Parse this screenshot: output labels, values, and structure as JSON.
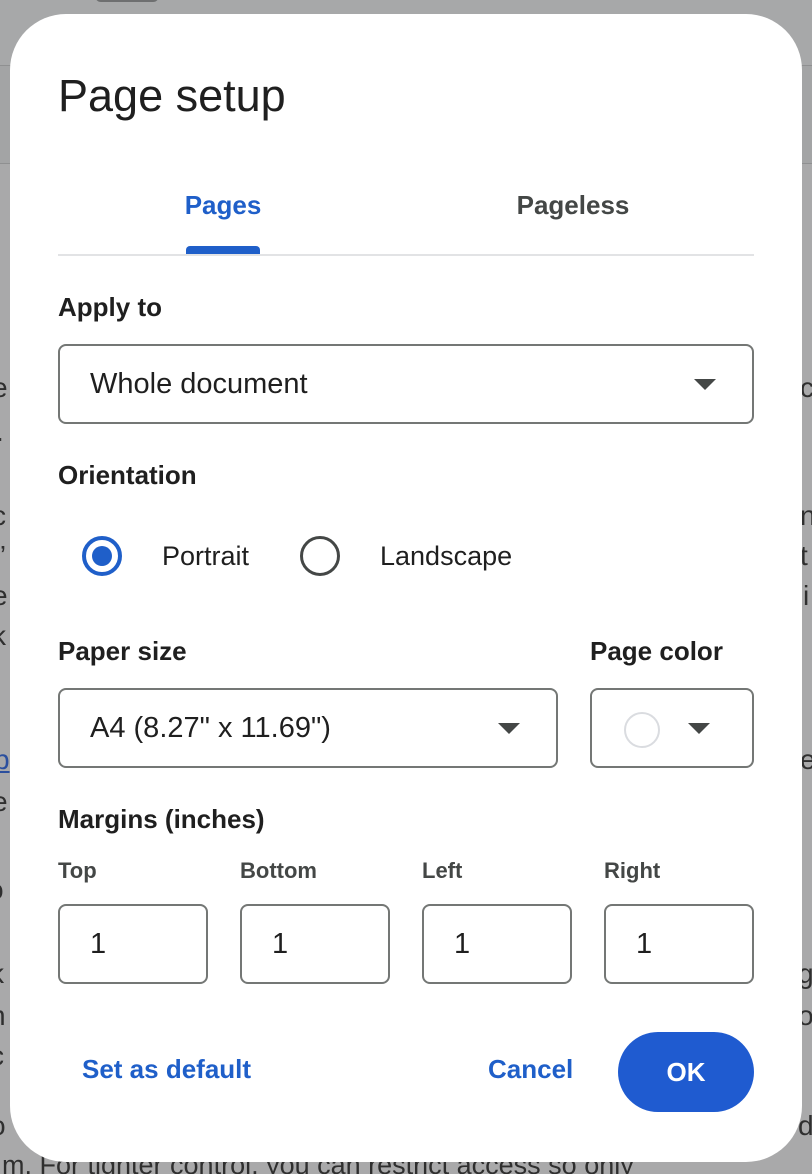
{
  "background": {
    "fragments": [
      "e",
      "c",
      ".",
      "c",
      "n",
      "”",
      "t",
      "e",
      "i",
      "k",
      "b",
      "e",
      "e",
      "o",
      "k",
      "g",
      "n",
      "o",
      "c",
      "o",
      "d"
    ],
    "bottom_text": "m. For tighter control, you can restrict access so only"
  },
  "dialog": {
    "title": "Page setup",
    "tabs": [
      {
        "label": "Pages",
        "selected": true
      },
      {
        "label": "Pageless",
        "selected": false
      }
    ],
    "apply_to": {
      "label": "Apply to",
      "value": "Whole document"
    },
    "orientation": {
      "label": "Orientation",
      "options": [
        {
          "label": "Portrait",
          "selected": true
        },
        {
          "label": "Landscape",
          "selected": false
        }
      ]
    },
    "paper_size": {
      "label": "Paper size",
      "value": "A4 (8.27\" x 11.69\")"
    },
    "page_color": {
      "label": "Page color",
      "value": "#ffffff"
    },
    "margins": {
      "label": "Margins (inches)",
      "fields": [
        {
          "label": "Top",
          "value": "1"
        },
        {
          "label": "Bottom",
          "value": "1"
        },
        {
          "label": "Left",
          "value": "1"
        },
        {
          "label": "Right",
          "value": "1"
        }
      ]
    },
    "buttons": {
      "set_default": "Set as default",
      "cancel": "Cancel",
      "ok": "OK"
    }
  },
  "colors": {
    "accent": "#1f5fc9",
    "ok_button": "#1f5bd0",
    "border": "#747775"
  }
}
